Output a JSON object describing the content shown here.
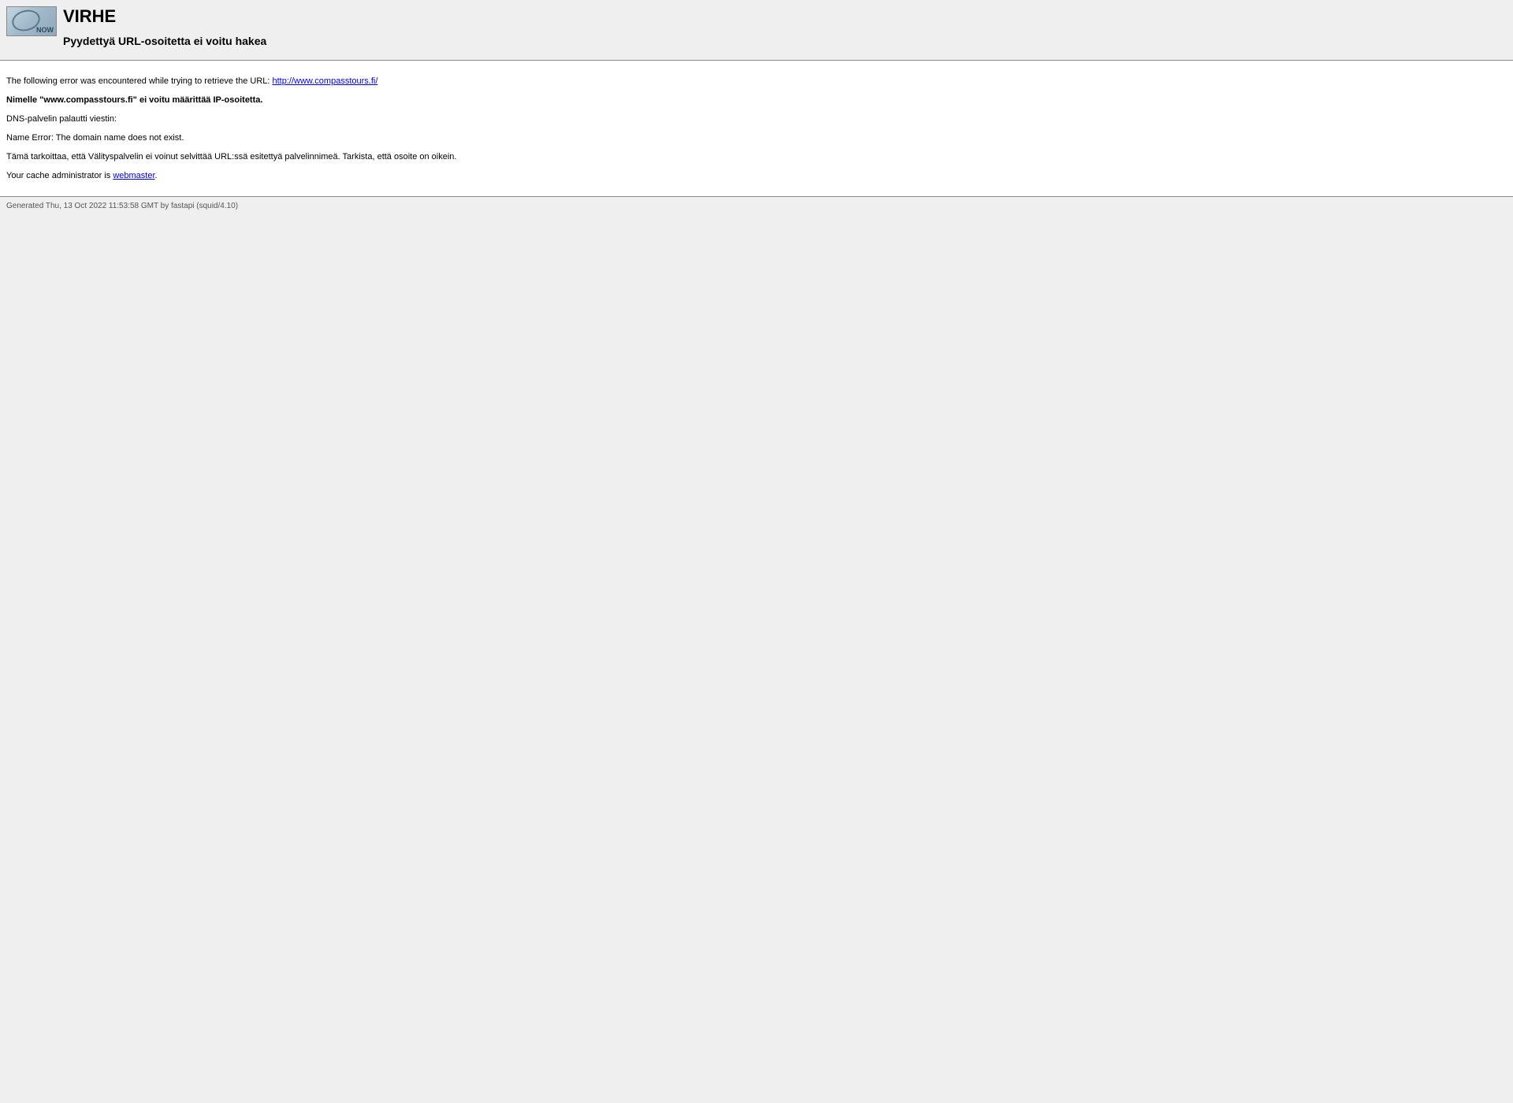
{
  "header": {
    "logo_overlay": "NOW",
    "title": "VIRHE",
    "subtitle": "Pyydettyä URL-osoitetta ei voitu hakea"
  },
  "content": {
    "intro": "The following error was encountered while trying to retrieve the URL: ",
    "url": "http://www.compasstours.fi/",
    "error_bold": "Nimelle \"www.compasstours.fi\" ei voitu määrittää IP-osoitetta.",
    "dns_label": "DNS-palvelin palautti viestin:",
    "dns_message": "Name Error: The domain name does not exist.",
    "explanation": "Tämä tarkoittaa, että Välityspalvelin ei voinut selvittää URL:ssä esitettyä palvelinnimeä. Tarkista, että osoite on oikein.",
    "admin_prefix": "Your cache administrator is ",
    "admin_link": "webmaster",
    "admin_suffix": "."
  },
  "footer": {
    "generated": "Generated Thu, 13 Oct 2022 11:53:58 GMT by fastapi (squid/4.10)"
  }
}
